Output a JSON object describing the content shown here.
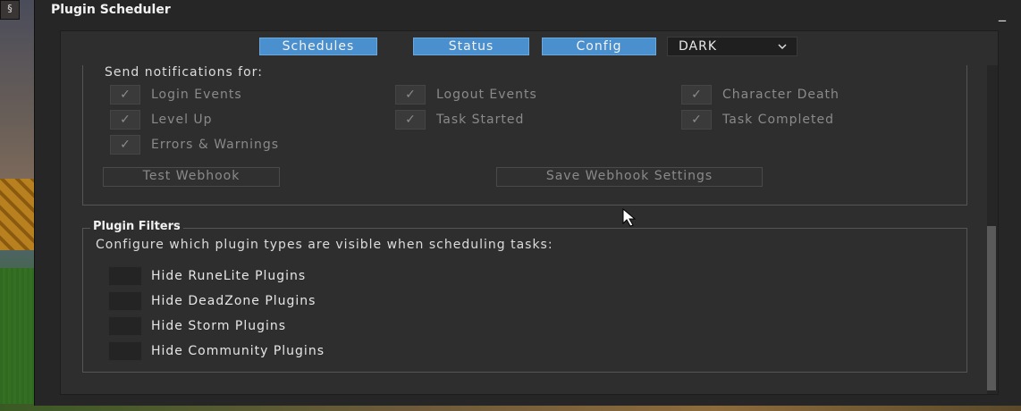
{
  "window": {
    "title": "Plugin Scheduler",
    "minimize_glyph": "_"
  },
  "tabs": [
    {
      "label": "Schedules"
    },
    {
      "label": "Status"
    },
    {
      "label": "Config"
    }
  ],
  "theme_select": {
    "value": "DARK",
    "icon": "chevron-down-icon"
  },
  "notifications": {
    "heading": "Send notifications for:",
    "options": [
      {
        "label": "Login Events",
        "checked": true
      },
      {
        "label": "Logout Events",
        "checked": true
      },
      {
        "label": "Character Death",
        "checked": true
      },
      {
        "label": "Level Up",
        "checked": true
      },
      {
        "label": "Task Started",
        "checked": true
      },
      {
        "label": "Task Completed",
        "checked": true
      },
      {
        "label": "Errors & Warnings",
        "checked": true
      }
    ],
    "test_button": "Test Webhook",
    "save_button": "Save Webhook Settings"
  },
  "plugin_filters": {
    "title": "Plugin Filters",
    "description": "Configure which plugin types are visible when scheduling tasks:",
    "options": [
      {
        "label": "Hide RuneLite Plugins",
        "checked": false
      },
      {
        "label": "Hide DeadZone Plugins",
        "checked": false
      },
      {
        "label": "Hide Storm Plugins",
        "checked": false
      },
      {
        "label": "Hide Community Plugins",
        "checked": false
      }
    ]
  },
  "colors": {
    "tab_active": "#4a8fce",
    "panel_bg": "#2e2e2e",
    "window_bg": "#262626",
    "text_enabled": "#e6e6e6",
    "text_disabled": "#8a8a8a"
  }
}
